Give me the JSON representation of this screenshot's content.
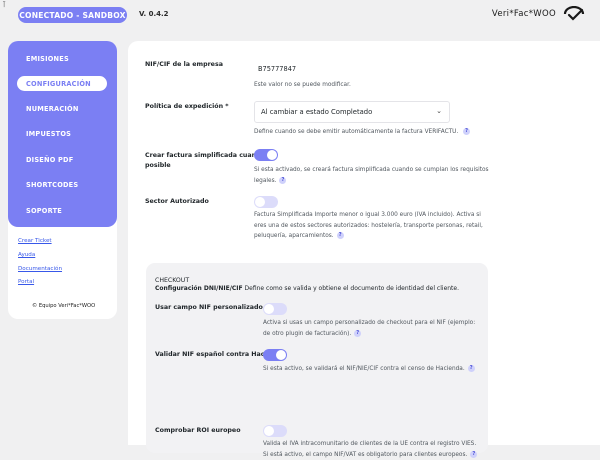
{
  "topbar": {
    "corner_mark": "⊺",
    "env_badge": "CONECTADO - SANDBOX",
    "version": "V. 0.4.2",
    "brand": "Veri*Fac*WOO"
  },
  "sidebar": {
    "menu": [
      {
        "label": "EMISIONES",
        "active": false
      },
      {
        "label": "CONFIGURACIÓN",
        "active": true
      },
      {
        "label": "NUMERACIÓN",
        "active": false
      },
      {
        "label": "IMPUESTOS",
        "active": false
      },
      {
        "label": "DISEÑO PDF",
        "active": false
      },
      {
        "label": "SHORTCODES",
        "active": false
      },
      {
        "label": "SOPORTE",
        "active": false
      }
    ],
    "links": [
      "Crear Ticket",
      "Ayuda",
      "Documentación",
      "Portal"
    ],
    "copyright": "© Equipo Veri*Fac*WOO"
  },
  "form": {
    "nif": {
      "label": "NIF/CIF de la empresa",
      "value": "B75777847",
      "desc": "Este valor no se puede modificar."
    },
    "policy": {
      "label": "Política de expedición",
      "required_mark": "*",
      "selected": "Al cambiar a estado Completado",
      "desc": "Define cuando se debe emitir automáticamente la factura VERIFACTU.",
      "help": "?"
    },
    "simplified": {
      "label_line1": "Crear factura simplificada cuando es",
      "label_line2": "posible",
      "enabled": true,
      "desc_line1": "Si esta activado, se creará factura simplificada cuando se cumplan los requisitos",
      "desc_line2": "legales.",
      "help": "?"
    },
    "sector": {
      "label": "Sector Autorizado",
      "enabled": false,
      "desc_line1": "Factura Simplificada Importe menor o igual 3.000 euro (IVA incluido). Activa si",
      "desc_line2": "eres una de estos sectores autorizados: hostelería, transporte personas, retail,",
      "desc_line3": "peluquería, aparcamientos.",
      "help": "?"
    }
  },
  "checkout": {
    "heading": "CHECKOUT",
    "sub_title": "Configuración DNI/NIE/CIF",
    "sub_text": " Define como se valida y obtiene el documento de identidad del cliente.",
    "custom_nif": {
      "label": "Usar campo NIF personalizado",
      "enabled": false,
      "desc_line1": "Activa si usas un campo personalizado de checkout para el NIF (ejemplo:",
      "desc_line2": "de otro plugin de facturación).",
      "help": "?"
    },
    "validate_nif": {
      "label": "Validar NIF español contra Hacienda",
      "enabled": true,
      "desc": "Si esta activo, se validará el NIF/NIE/CIF contra el censo de Hacienda.",
      "help": "?"
    },
    "roi": {
      "label": "Comprobar ROI europeo",
      "enabled": false,
      "desc_line1": "Valida el IVA intracomunitario de clientes de la UE contra el registro VIES.",
      "desc_line2": "Si está activo, el campo NIF/VAT es obligatorio para clientes europeos.",
      "help": "?"
    }
  },
  "colors": {
    "accent": "#7b7ff3",
    "background": "#f0f0f1",
    "toggle_off": "#dcdcfa",
    "link": "#3858e9"
  }
}
